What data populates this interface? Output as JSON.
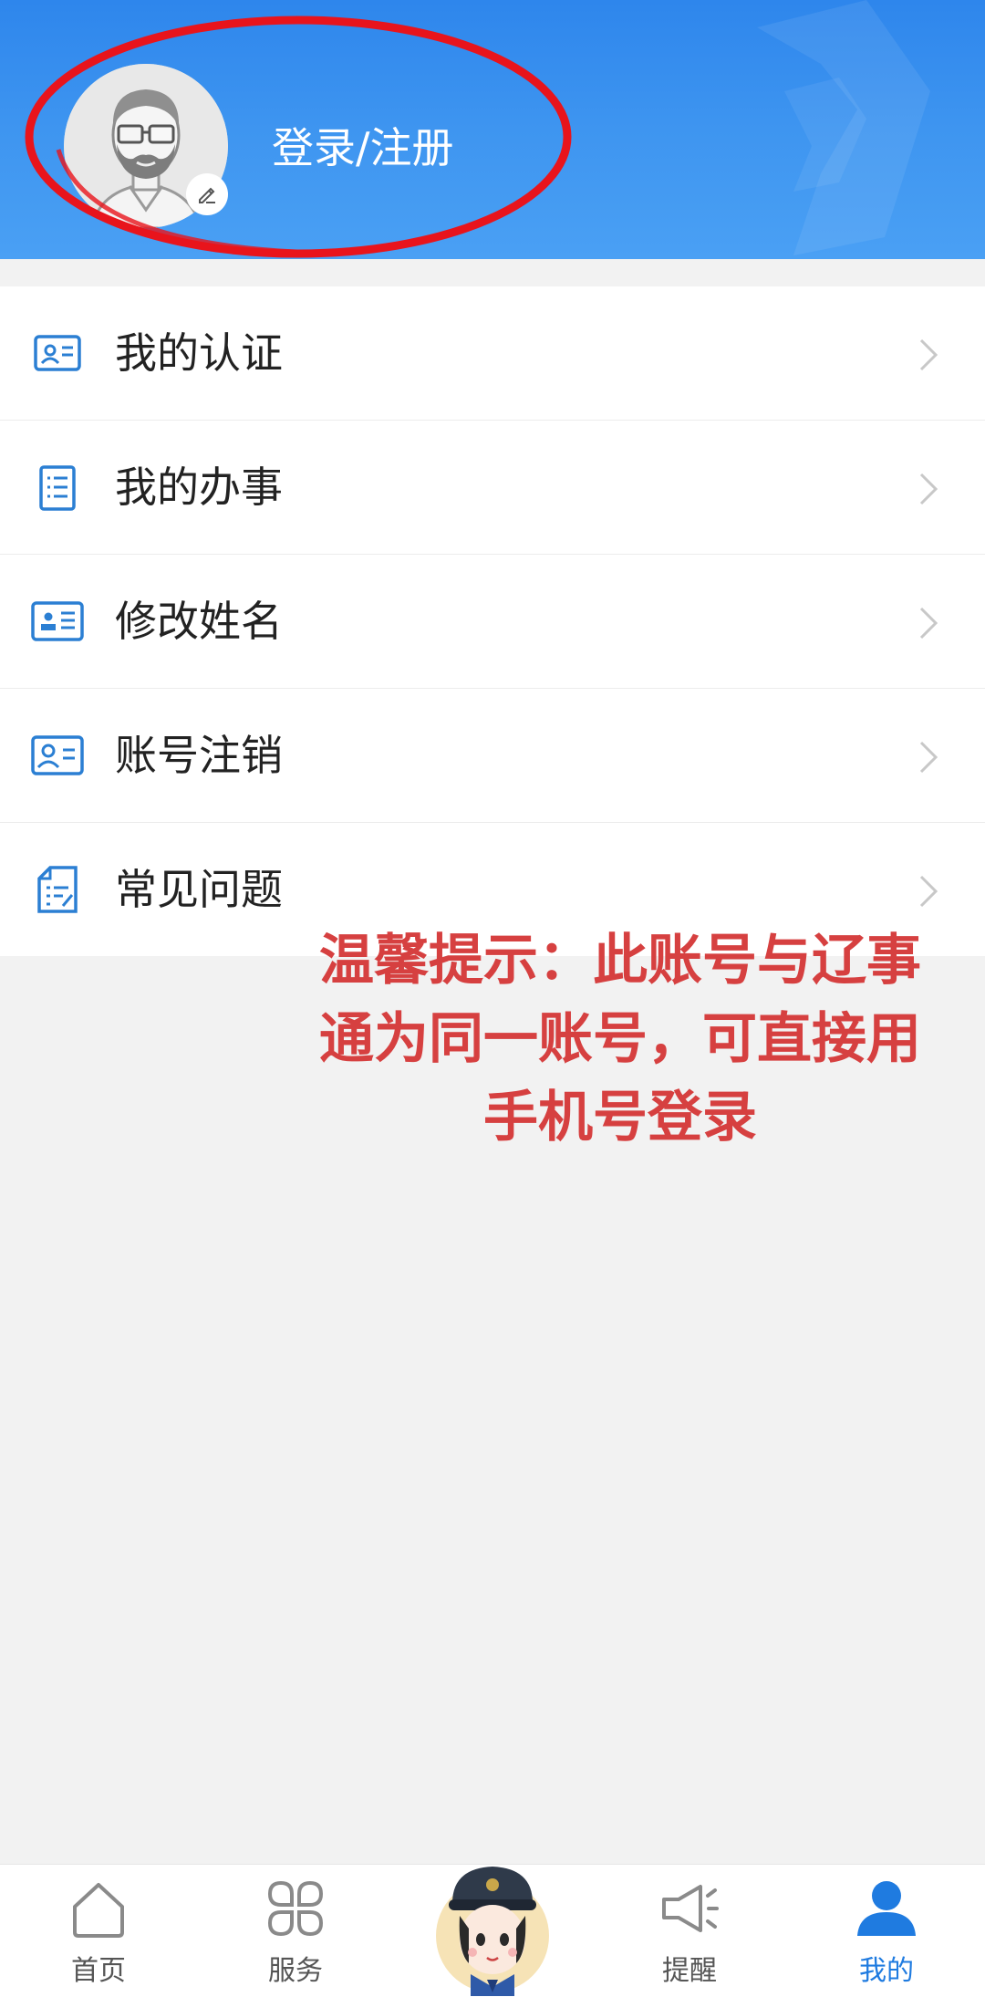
{
  "header": {
    "login_label": "登录/注册"
  },
  "menu": {
    "items": [
      {
        "label": "我的认证",
        "icon": "id-card-icon"
      },
      {
        "label": "我的办事",
        "icon": "list-document-icon"
      },
      {
        "label": "修改姓名",
        "icon": "name-card-icon"
      },
      {
        "label": "账号注销",
        "icon": "id-card-icon"
      },
      {
        "label": "常见问题",
        "icon": "faq-document-icon"
      }
    ]
  },
  "note": {
    "lines": [
      "温馨提示：此账号与辽事",
      "通为同一账号，可直接用",
      "手机号登录"
    ]
  },
  "bottom_nav": {
    "items": [
      {
        "label": "首页",
        "icon": "home-icon",
        "active": false
      },
      {
        "label": "服务",
        "icon": "grid-icon",
        "active": false
      },
      {
        "label": "",
        "icon": "police-mascot-icon",
        "active": false
      },
      {
        "label": "提醒",
        "icon": "megaphone-icon",
        "active": false
      },
      {
        "label": "我的",
        "icon": "user-icon",
        "active": true
      }
    ]
  },
  "colors": {
    "header_blue": "#2e86ec",
    "accent_blue": "#1f7be0",
    "icon_blue": "#2b7fd3",
    "note_red": "#d64040",
    "ring_red": "#e8141c"
  }
}
